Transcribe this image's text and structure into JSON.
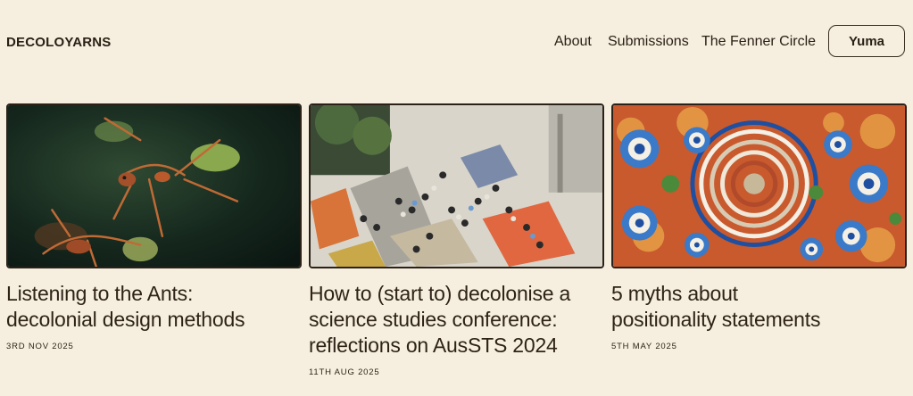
{
  "header": {
    "brand": "DECOLOYARNS",
    "nav": [
      {
        "label": "About"
      },
      {
        "label": "Submissions"
      },
      {
        "label": "The Fenner Circle"
      }
    ],
    "cta_label": "Yuma"
  },
  "posts": [
    {
      "title_lines": [
        "Listening to the Ants:",
        "decolonial design methods"
      ],
      "date": "3RD NOV 2025",
      "image": "ants-photo"
    },
    {
      "title_lines": [
        "How to (start to) decolonise a",
        "science studies conference:",
        "reflections on AusSTS 2024"
      ],
      "date": "11TH AUG 2025",
      "image": "conference-photo"
    },
    {
      "title_lines": [
        "5 myths about",
        "positionality statements"
      ],
      "date": "5TH MAY 2025",
      "image": "dot-painting"
    }
  ],
  "colors": {
    "background": "#f6efdf",
    "text": "#2e2316"
  }
}
